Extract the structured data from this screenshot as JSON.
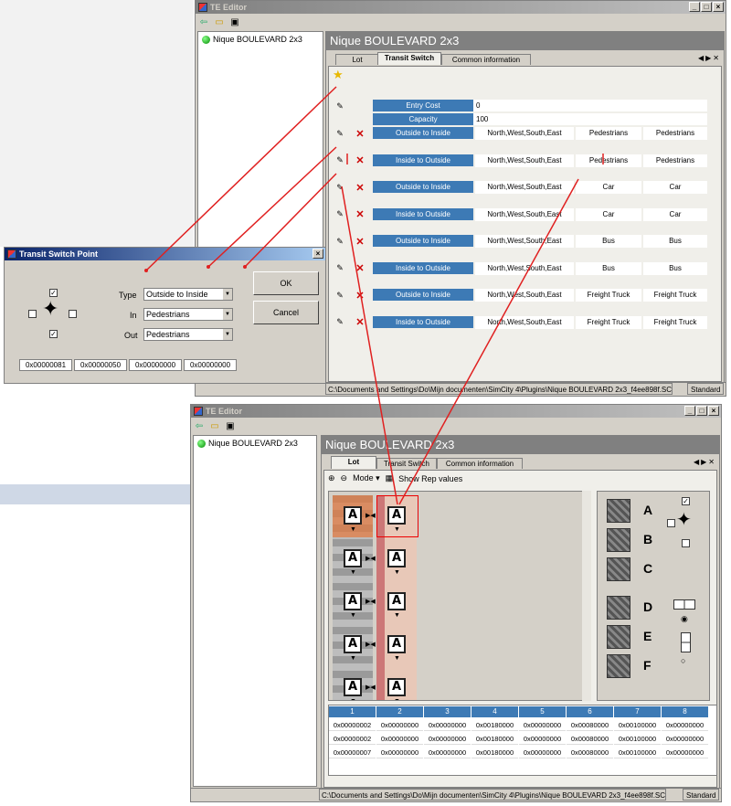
{
  "window_top": {
    "title": "TE Editor",
    "tree_item": "Nique BOULEVARD 2x3",
    "header": "Nique BOULEVARD 2x3",
    "tabs": [
      "Lot",
      "Transit Switch",
      "Common information"
    ],
    "active_tab": "Transit Switch",
    "entry_cost_label": "Entry Cost",
    "entry_cost_value": "0",
    "capacity_label": "Capacity",
    "capacity_value": "100",
    "rows": [
      {
        "dir": "Outside to Inside",
        "sides": "North,West,South,East",
        "in": "Pedestrians",
        "out": "Pedestrians"
      },
      {
        "dir": "Inside to Outside",
        "sides": "North,West,South,East",
        "in": "Pedestrians",
        "out": "Pedestrians"
      },
      {
        "dir": "Outside to Inside",
        "sides": "North,West,South,East",
        "in": "Car",
        "out": "Car"
      },
      {
        "dir": "Inside to Outside",
        "sides": "North,West,South,East",
        "in": "Car",
        "out": "Car"
      },
      {
        "dir": "Outside to Inside",
        "sides": "North,West,South,East",
        "in": "Bus",
        "out": "Bus"
      },
      {
        "dir": "Inside to Outside",
        "sides": "North,West,South,East",
        "in": "Bus",
        "out": "Bus"
      },
      {
        "dir": "Outside to Inside",
        "sides": "North,West,South,East",
        "in": "Freight Truck",
        "out": "Freight Truck"
      },
      {
        "dir": "Inside to Outside",
        "sides": "North,West,South,East",
        "in": "Freight Truck",
        "out": "Freight Truck"
      }
    ],
    "status_path": "C:\\Documents and Settings\\Do\\Mijn documenten\\SimCity 4\\Plugins\\Nique BOULEVARD 2x3_f4ee898f.SC4l",
    "status_mode": "Standard"
  },
  "dialog": {
    "title": "Transit Switch Point",
    "type_label": "Type",
    "type_value": "Outside to Inside",
    "in_label": "In",
    "in_value": "Pedestrians",
    "out_label": "Out",
    "out_value": "Pedestrians",
    "ok": "OK",
    "cancel": "Cancel",
    "hex": [
      "0x00000081",
      "0x00000050",
      "0x00000000",
      "0x00000000"
    ]
  },
  "window_bottom": {
    "title": "TE Editor",
    "tree_item": "Nique BOULEVARD 2x3",
    "header": "Nique BOULEVARD 2x3",
    "tabs": [
      "Lot",
      "Transit Switch",
      "Common information"
    ],
    "active_tab": "Lot",
    "mode_label": "Mode",
    "show_rep": "Show Rep values",
    "tile_letter": "A",
    "palette": [
      "A",
      "B",
      "C",
      "D",
      "E",
      "F"
    ],
    "grid_headers": [
      "1",
      "2",
      "3",
      "4",
      "5",
      "6",
      "7",
      "8"
    ],
    "grid_rows": [
      [
        "0x00000002",
        "0x00000000",
        "0x00000000",
        "0x00180000",
        "0x00000000",
        "0x00080000",
        "0x00100000",
        "0x00000000"
      ],
      [
        "0x00000002",
        "0x00000000",
        "0x00000000",
        "0x00180000",
        "0x00000000",
        "0x00080000",
        "0x00100000",
        "0x00000000"
      ],
      [
        "0x00000007",
        "0x00000000",
        "0x00000000",
        "0x00180000",
        "0x00000000",
        "0x00080000",
        "0x00100000",
        "0x00000000"
      ]
    ],
    "status_path": "C:\\Documents and Settings\\Do\\Mijn documenten\\SimCity 4\\Plugins\\Nique BOULEVARD 2x3_f4ee898f.SC4l",
    "status_mode": "Standard"
  },
  "colors": {
    "accent": "#3d7ab5",
    "arrow": "#e02020",
    "title_active": "#0a246a"
  }
}
